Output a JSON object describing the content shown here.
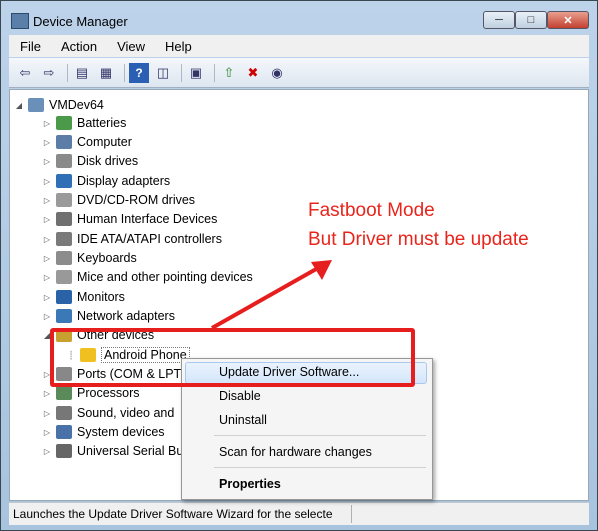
{
  "window": {
    "title": "Device Manager"
  },
  "menu": [
    "File",
    "Action",
    "View",
    "Help"
  ],
  "toolbar_icons": [
    "back-arrow-icon",
    "forward-arrow-icon",
    "show-hide-console-tree-icon",
    "properties-icon",
    "help-icon",
    "action-pane-icon",
    "scan-hardware-icon",
    "update-driver-icon",
    "uninstall-icon",
    "disable-icon"
  ],
  "tree": {
    "root": "VMDev64",
    "categories": [
      "Batteries",
      "Computer",
      "Disk drives",
      "Display adapters",
      "DVD/CD-ROM drives",
      "Human Interface Devices",
      "IDE ATA/ATAPI controllers",
      "Keyboards",
      "Mice and other pointing devices",
      "Monitors",
      "Network adapters",
      "Other devices",
      "Ports (COM & LPT",
      "Processors",
      "Sound, video and",
      "System devices",
      "Universal Serial Bu"
    ],
    "child_device": "Android Phone"
  },
  "context_menu": {
    "items": [
      "Update Driver Software...",
      "Disable",
      "Uninstall",
      "Scan for hardware changes",
      "Properties"
    ]
  },
  "status": {
    "text": "Launches the Update Driver Software Wizard for the selecte"
  },
  "annotation": {
    "line1": "Fastboot Mode",
    "line2": "But Driver must be update",
    "color": "#e8251c"
  }
}
